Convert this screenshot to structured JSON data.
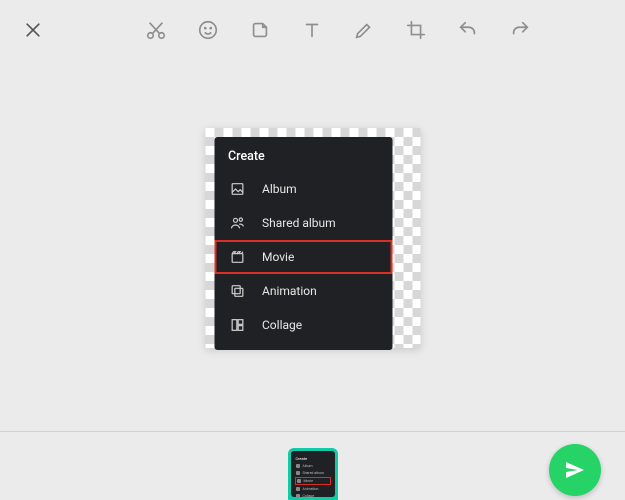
{
  "toolbar": {
    "close": "close",
    "tools": [
      "cut-icon",
      "emoji-icon",
      "sticker-icon",
      "text-icon",
      "draw-icon",
      "crop-icon",
      "undo-icon",
      "redo-icon"
    ]
  },
  "menu": {
    "title": "Create",
    "items": [
      {
        "icon": "image-icon",
        "label": "Album",
        "highlighted": false
      },
      {
        "icon": "shared-album-icon",
        "label": "Shared album",
        "highlighted": false
      },
      {
        "icon": "movie-icon",
        "label": "Movie",
        "highlighted": true
      },
      {
        "icon": "animation-icon",
        "label": "Animation",
        "highlighted": false
      },
      {
        "icon": "collage-icon",
        "label": "Collage",
        "highlighted": false
      }
    ]
  },
  "thumb": {
    "title": "Create",
    "rows": [
      "Album",
      "Shared album",
      "Movie",
      "Animation",
      "Collage"
    ]
  },
  "send": {
    "label": "Send"
  }
}
